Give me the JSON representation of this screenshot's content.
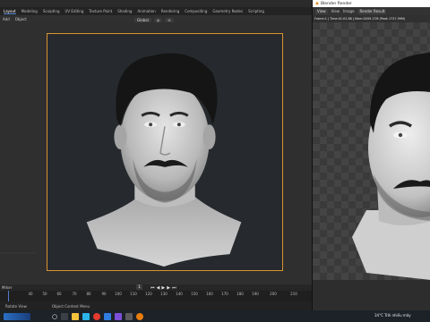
{
  "blender": {
    "workspace_tabs": [
      "Layout",
      "Modeling",
      "Sculpting",
      "UV Editing",
      "Texture Paint",
      "Shading",
      "Animation",
      "Rendering",
      "Compositing",
      "Geometry Nodes",
      "Scripting"
    ],
    "header_menu": [
      "Add",
      "Object"
    ],
    "transform_orientation": "Global",
    "timeline_label": "Mrker",
    "current_frame": "1",
    "timeline_ticks": [
      "40",
      "50",
      "60",
      "70",
      "80",
      "90",
      "100",
      "110",
      "120",
      "130",
      "140",
      "150",
      "160",
      "170",
      "180",
      "190",
      "200",
      "210"
    ],
    "status": [
      "Rotate View",
      "Object Context Menu"
    ]
  },
  "render_window": {
    "title": "Blender Render",
    "menu": [
      "View",
      "View",
      "Image",
      "Render Result"
    ],
    "info": "Frame:1 | Time:01:02.88 | Mem:3459.17M (Peak 1737.99M)"
  },
  "taskbar": {
    "weather": "34°C  Trời nhiều mây",
    "accent": "#d9922e"
  }
}
